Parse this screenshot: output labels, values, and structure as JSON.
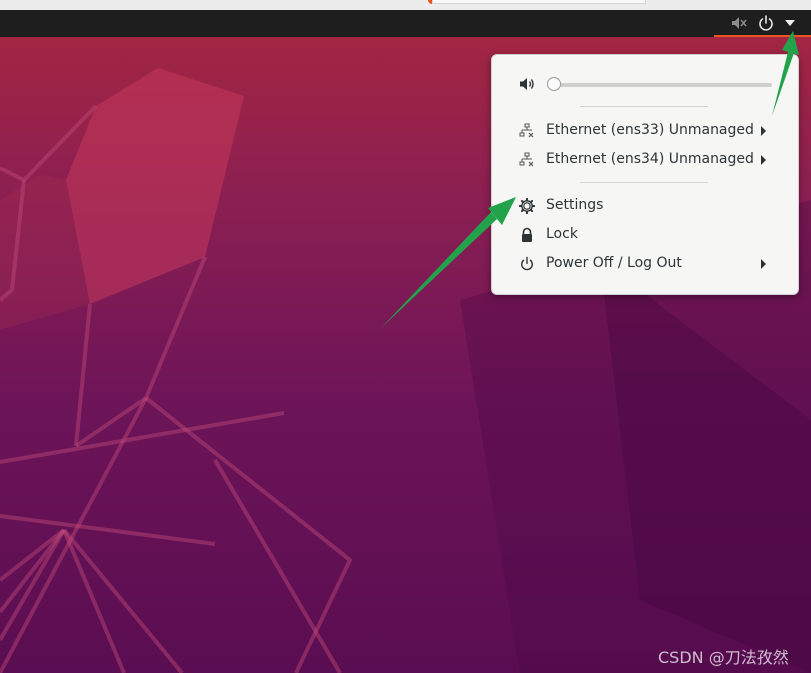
{
  "topbar": {
    "icons": [
      "volume-muted-icon",
      "power-icon",
      "dropdown-arrow-icon"
    ]
  },
  "system_menu": {
    "volume": {
      "icon": "speaker-icon",
      "level": 0
    },
    "network": [
      {
        "label": "Ethernet (ens33) Unmanaged",
        "icon": "wired-network-disconnected-icon",
        "has_submenu": true
      },
      {
        "label": "Ethernet (ens34) Unmanaged",
        "icon": "wired-network-disconnected-icon",
        "has_submenu": true
      }
    ],
    "settings": {
      "label": "Settings",
      "icon": "gear-icon"
    },
    "lock": {
      "label": "Lock",
      "icon": "lock-icon"
    },
    "power": {
      "label": "Power Off / Log Out",
      "icon": "power-icon",
      "has_submenu": true
    }
  },
  "watermark": "CSDN @刀法孜然",
  "colors": {
    "topbar": "#1e1e1e",
    "accent": "#e95420",
    "menu_bg": "#f6f6f5",
    "annotation_arrow": "#22a24a",
    "wallpaper_top": "#a8273f",
    "wallpaper_bottom": "#5a0d52"
  }
}
